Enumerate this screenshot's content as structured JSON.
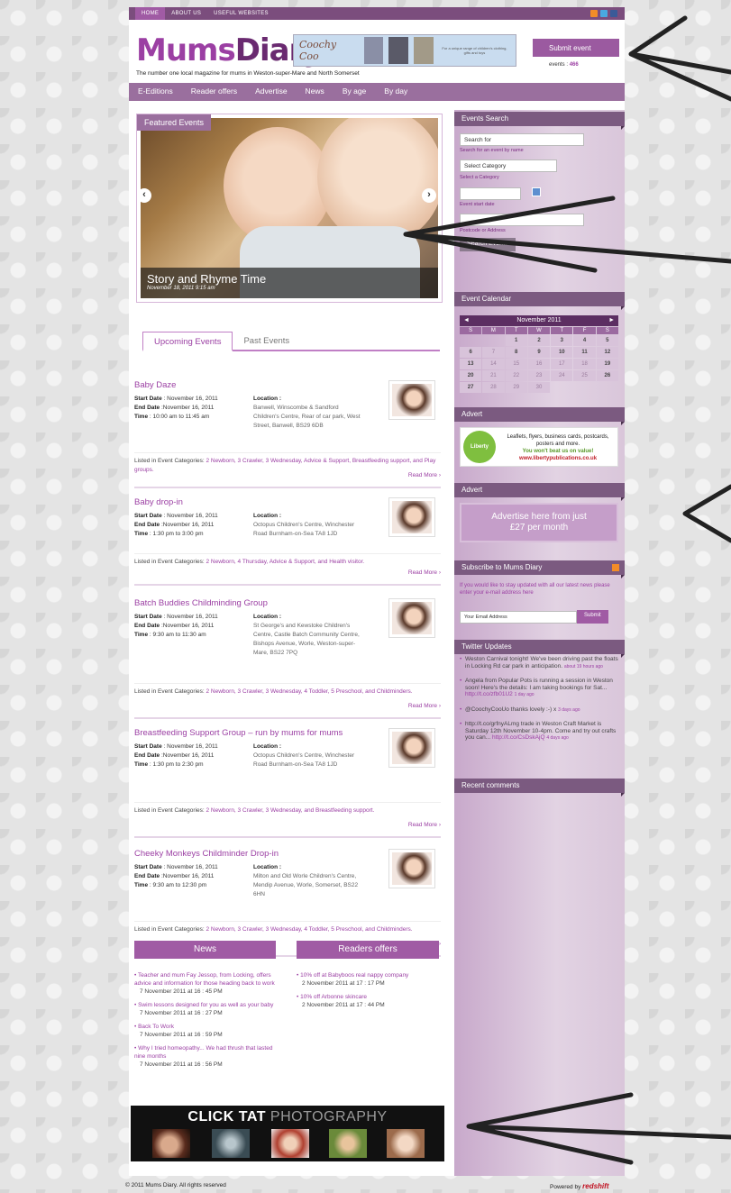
{
  "topnav": {
    "items": [
      "HOME",
      "ABOUT US",
      "USEFUL WEBSITES"
    ]
  },
  "header": {
    "logo_a": "Mums",
    "logo_b": "Diary",
    "tagline": "The number one local magazine for mums in Weston-super-Mare and North Somerset",
    "banner_title": "Coochy Coo",
    "banner_text": "For a unique range of children's clothing, gifts and toys",
    "submit_label": "Submit event",
    "events_label": "events :",
    "events_count": "466"
  },
  "mainnav": {
    "items": [
      "E-Editions",
      "Reader offers",
      "Advertise",
      "News",
      "By age",
      "By day"
    ]
  },
  "featured": {
    "tab": "Featured Events",
    "title": "Story and Rhyme Time",
    "date": "November 18, 2011 9:15 am",
    "prev": "‹",
    "next": "›"
  },
  "tabs": {
    "upcoming": "Upcoming Events",
    "past": "Past Events"
  },
  "labels": {
    "start": "Start Date",
    "end": "End Date",
    "time": "Time",
    "location": "Location :",
    "listed": "Listed in Event Categories:",
    "read_more": "Read More ›"
  },
  "events": [
    {
      "title": "Baby Daze",
      "start": ": November 16, 2011",
      "end": ":November 16, 2011",
      "time": ": 10:00 am to 11:45 am",
      "location": "Banwell, Winscombe & Sandford Children's Centre, Rear of car park, West Street, Banwell, BS29 6DB",
      "cats": "2 Newborn, 3 Crawler, 3 Wednesday, Advice & Support, Breastfeeding support, and Play groups."
    },
    {
      "title": "Baby drop-in",
      "start": ": November 16, 2011",
      "end": ":November 16, 2011",
      "time": ": 1:30 pm to 3:00 pm",
      "location": "Octopus Children's Centre, Winchester Road Burnham-on-Sea TA8 1JD",
      "cats": "2 Newborn, 4 Thursday, Advice & Support, and Health visitor."
    },
    {
      "title": "Batch Buddies Childminding Group",
      "start": ": November 16, 2011",
      "end": ":November 16, 2011",
      "time": ": 9:30 am to 11:30 am",
      "location": "St George's and Kewstoke Children's Centre, Castle Batch Community Centre, Bishops Avenue, Worle, Weston-super-Mare, BS22 7PQ",
      "cats": "2 Newborn, 3 Crawler, 3 Wednesday, 4 Toddler, 5 Preschool, and Childminders."
    },
    {
      "title": "Breastfeeding Support Group – run by mums for mums",
      "start": ": November 16, 2011",
      "end": ":November 16, 2011",
      "time": ": 1:30 pm to 2:30 pm",
      "location": "Octopus Children's Centre, Winchester Road Burnham-on-Sea TA8 1JD",
      "cats": "2 Newborn, 3 Crawler, 3 Wednesday, and Breastfeeding support."
    },
    {
      "title": "Cheeky Monkeys Childminder Drop-in",
      "start": ": November 16, 2011",
      "end": ":November 16, 2011",
      "time": ": 9:30 am to 12:30 pm",
      "location": "Milton and Old Worle Children's Centre, Mendip Avenue, Worle, Somerset, BS22 6HN",
      "cats": "2 Newborn, 3 Crawler, 3 Wednesday, 4 Toddler, 5 Preschool, and Childminders."
    }
  ],
  "news": {
    "heading": "News",
    "items": [
      {
        "title": "Teacher and mum Fay Jessop, from Locking, offers advice and information for those heading back to work",
        "date": "7 November 2011 at 16 : 45 PM"
      },
      {
        "title": "Swim lessons designed for you as well as your baby",
        "date": "7 November 2011 at 16 : 27 PM"
      },
      {
        "title": "Back To Work",
        "date": "7 November 2011 at 16 : 59 PM"
      },
      {
        "title": "Why I tried homeopathy... We had thrush that lasted nine months",
        "date": "7 November 2011 at 16 : 56 PM"
      }
    ]
  },
  "offers": {
    "heading": "Readers offers",
    "items": [
      {
        "title": "10% off at Babyboos real nappy company",
        "date": "2 November 2011 at 17 : 17 PM"
      },
      {
        "title": "10% off Arbonne skincare",
        "date": "2 November 2011 at 17 : 44 PM"
      }
    ]
  },
  "clicktat": {
    "a": "CLICK TAT",
    "b": " PHOTOGRAPHY"
  },
  "sidebar": {
    "search_h": "Events Search",
    "search_ph": "Search for",
    "search_lbl": "Search for an event by name",
    "category": "Select Category",
    "category_lbl": "Select a Category",
    "date_lbl": "Event start date",
    "postcode_lbl": "Postcode or Address",
    "search_btn": "Search Events",
    "cal_h": "Event Calendar",
    "cal_month": "November 2011",
    "cal_prev": "◄",
    "cal_next": "►",
    "cal_days": [
      "S",
      "M",
      "T",
      "W",
      "T",
      "F",
      "S"
    ],
    "advert_h": "Advert",
    "advert1_logo": "Liberty",
    "advert1_l1": "Leaflets, flyers, business cards, postcards, posters and more.",
    "advert1_l2": "You won't beat us on value!",
    "advert1_l3": "www.libertypublications.co.uk",
    "advert2_h": "Advert",
    "advert2_l1": "Advertise here from just",
    "advert2_l2": "£27 per month",
    "subscribe_h": "Subscribe to Mums Diary",
    "subscribe_txt": "If you would like to stay updated with all our latest news please enter your e-mail address here",
    "email_ph": "Your Email Address",
    "submit": "Submit",
    "twitter_h": "Twitter Updates",
    "tweets": [
      {
        "text": "Weston Carnival tonight! We've been driving past the floats in Locking Rd car park in anticipation.",
        "ago": "about 19 hours ago"
      },
      {
        "text": "Angela from Popular Pots is running a session in Weston soon! Here's the details: I am taking bookings for Sat...",
        "link": "http://t.co/zfb01U2",
        "ago": "1 day ago"
      },
      {
        "text": "@CoochyCooUo thanks lovely :-) x",
        "ago": "3 days ago"
      },
      {
        "text": "http://t.co/grfnyALmg trade in Weston Craft Market is Saturday 12th November 10-4pm. Come and try out crafts you can...",
        "link": "http://t.co/CsDskAjQ",
        "ago": "4 days ago"
      }
    ],
    "comments_h": "Recent comments"
  },
  "footer": {
    "copy": "© 2011 Mums Diary. All rights reserved",
    "powered": "Powered by ",
    "brand": "redshift"
  }
}
